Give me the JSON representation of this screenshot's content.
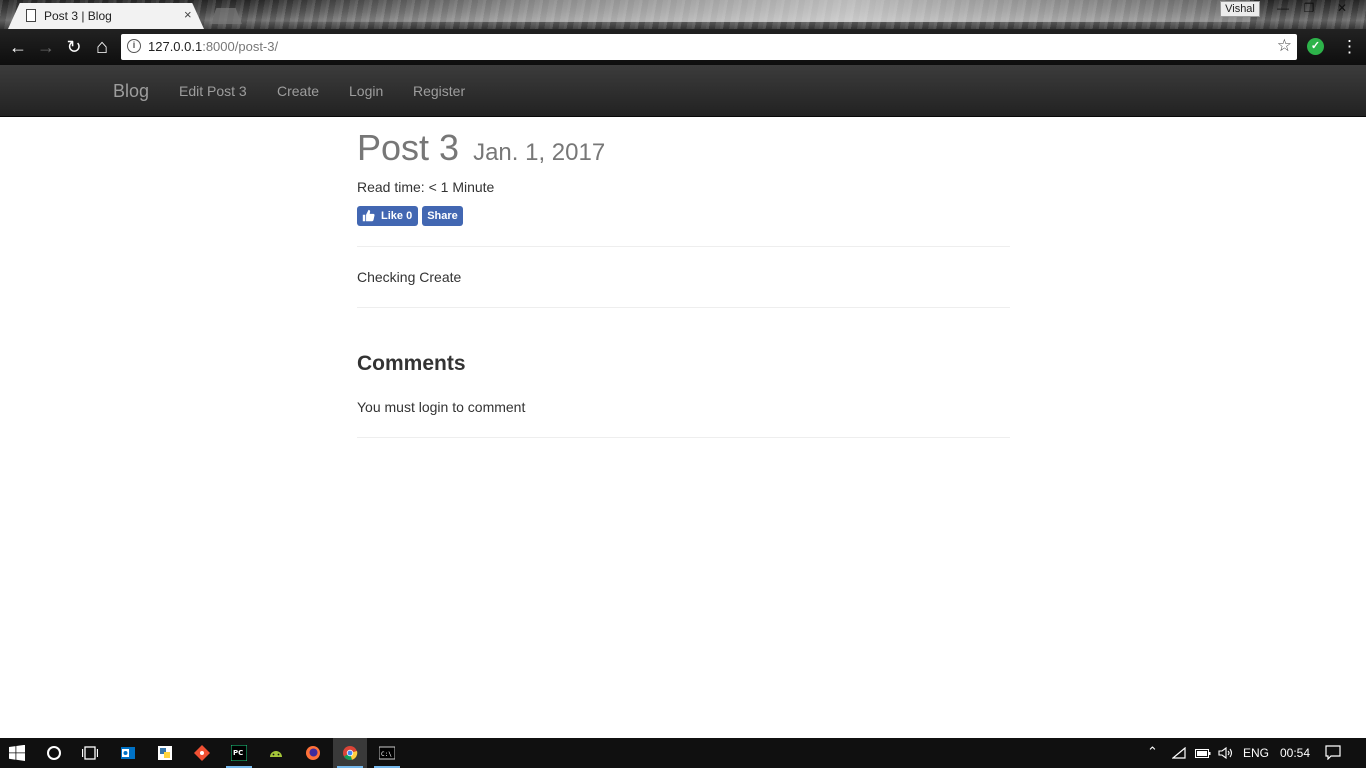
{
  "browser": {
    "tab_title": "Post 3 | Blog",
    "tab_close": "×",
    "user_badge": "Vishal",
    "window_controls": {
      "minimize": "—",
      "maximize": "❐",
      "close": "✕"
    },
    "url_host": "127.0.0.1",
    "url_rest": ":8000/post-3/",
    "nav": {
      "back": "←",
      "forward": "→",
      "reload": "↻",
      "home": "⌂"
    },
    "star": "☆",
    "menu": "⋮",
    "extension_check": "✓"
  },
  "site_nav": {
    "brand": "Blog",
    "links": [
      "Edit Post 3",
      "Create",
      "Login",
      "Register"
    ]
  },
  "post": {
    "title": "Post 3",
    "date": "Jan. 1, 2017",
    "read_time": "Read time: < 1 Minute",
    "like_label": "Like 0",
    "share_label": "Share",
    "body": "Checking Create"
  },
  "comments": {
    "heading": "Comments",
    "login_note": "You must login to comment"
  },
  "taskbar": {
    "language": "ENG",
    "time": "00:54",
    "apps": [
      "windows-start",
      "cortana",
      "task-view",
      "outlook",
      "python-idle",
      "git",
      "pycharm",
      "android-studio",
      "firefox",
      "chrome",
      "cmd"
    ]
  },
  "colors": {
    "navbar_bg": "#222222",
    "nav_link": "#9d9d9d",
    "facebook_blue": "#4267b2",
    "taskbar_bg": "#101010"
  }
}
